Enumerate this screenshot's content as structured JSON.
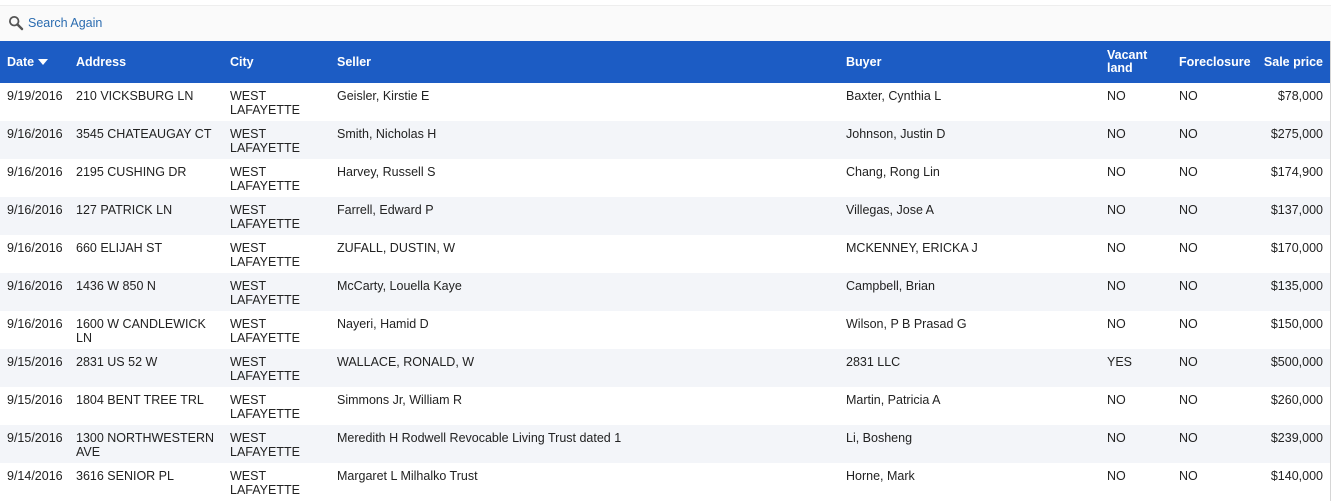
{
  "toolbar": {
    "search_again_label": "Search Again",
    "search_icon": "search-icon"
  },
  "table": {
    "columns": {
      "date": "Date",
      "address": "Address",
      "city": "City",
      "seller": "Seller",
      "buyer": "Buyer",
      "vacant_land_line1": "Vacant",
      "vacant_land_line2": "land",
      "foreclosure": "Foreclosure",
      "sale_price": "Sale price"
    },
    "sort": {
      "column": "Date",
      "direction": "descending"
    },
    "rows": [
      {
        "date": "9/19/2016",
        "address": "210 VICKSBURG LN",
        "city1": "WEST",
        "city2": "LAFAYETTE",
        "seller": "Geisler, Kirstie E",
        "buyer": "Baxter, Cynthia L",
        "vacant": "NO",
        "foreclosure": "NO",
        "price": "$78,000"
      },
      {
        "date": "9/16/2016",
        "address": "3545 CHATEAUGAY CT",
        "city1": "WEST",
        "city2": "LAFAYETTE",
        "seller": "Smith, Nicholas H",
        "buyer": "Johnson, Justin D",
        "vacant": "NO",
        "foreclosure": "NO",
        "price": "$275,000"
      },
      {
        "date": "9/16/2016",
        "address": "2195 CUSHING DR",
        "city1": "WEST",
        "city2": "LAFAYETTE",
        "seller": "Harvey, Russell S",
        "buyer": "Chang, Rong Lin",
        "vacant": "NO",
        "foreclosure": "NO",
        "price": "$174,900"
      },
      {
        "date": "9/16/2016",
        "address": "127 PATRICK LN",
        "city1": "WEST",
        "city2": "LAFAYETTE",
        "seller": "Farrell, Edward P",
        "buyer": "Villegas, Jose A",
        "vacant": "NO",
        "foreclosure": "NO",
        "price": "$137,000"
      },
      {
        "date": "9/16/2016",
        "address": "660 ELIJAH ST",
        "city1": "WEST",
        "city2": "LAFAYETTE",
        "seller": "ZUFALL, DUSTIN, W",
        "buyer": "MCKENNEY, ERICKA J",
        "vacant": "NO",
        "foreclosure": "NO",
        "price": "$170,000"
      },
      {
        "date": "9/16/2016",
        "address": "1436 W 850 N",
        "city1": "WEST",
        "city2": "LAFAYETTE",
        "seller": "McCarty, Louella Kaye",
        "buyer": "Campbell, Brian",
        "vacant": "NO",
        "foreclosure": "NO",
        "price": "$135,000"
      },
      {
        "date": "9/16/2016",
        "address": "1600 W CANDLEWICK LN",
        "city1": "WEST",
        "city2": "LAFAYETTE",
        "seller": "Nayeri, Hamid D",
        "buyer": "Wilson, P B Prasad G",
        "vacant": "NO",
        "foreclosure": "NO",
        "price": "$150,000"
      },
      {
        "date": "9/15/2016",
        "address": "2831 US 52 W",
        "city1": "WEST",
        "city2": "LAFAYETTE",
        "seller": "WALLACE, RONALD, W",
        "buyer": "2831 LLC",
        "vacant": "YES",
        "foreclosure": "NO",
        "price": "$500,000"
      },
      {
        "date": "9/15/2016",
        "address": "1804 BENT TREE TRL",
        "city1": "WEST",
        "city2": "LAFAYETTE",
        "seller": "Simmons Jr, William R",
        "buyer": "Martin, Patricia A",
        "vacant": "NO",
        "foreclosure": "NO",
        "price": "$260,000"
      },
      {
        "date": "9/15/2016",
        "address": "1300 NORTHWESTERN AVE",
        "city1": "WEST",
        "city2": "LAFAYETTE",
        "seller": "Meredith H Rodwell Revocable Living Trust dated 1",
        "buyer": "Li, Bosheng",
        "vacant": "NO",
        "foreclosure": "NO",
        "price": "$239,000"
      },
      {
        "date": "9/14/2016",
        "address": "3616 SENIOR PL",
        "city1": "WEST",
        "city2": "LAFAYETTE",
        "seller": "Margaret L Milhalko Trust",
        "buyer": "Horne, Mark",
        "vacant": "NO",
        "foreclosure": "NO",
        "price": "$140,000"
      }
    ]
  },
  "colors": {
    "header_bg": "#1c5cc4",
    "header_text": "#ffffff",
    "link": "#2b6cb0",
    "row_alt": "#f3f5f9"
  }
}
